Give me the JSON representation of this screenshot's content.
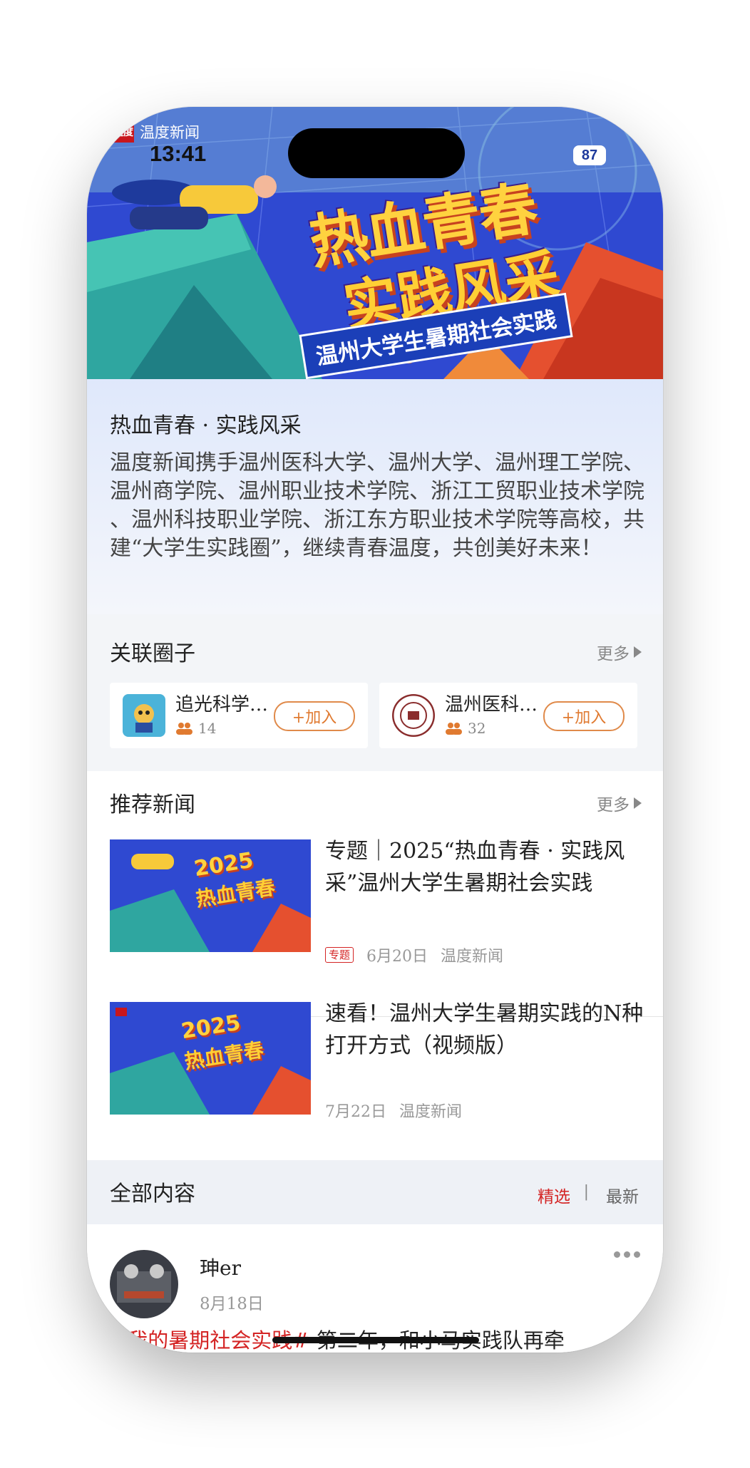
{
  "status_bar": {
    "app_name": "温度新闻",
    "app_logo_text": "温度",
    "time": "13:41",
    "battery": "87"
  },
  "banner": {
    "title_line1": "热血青春",
    "title_line2": "实践风采",
    "subtitle": "温州大学生暑期社会实践"
  },
  "intro": {
    "title": "热血青春 · 实践风采",
    "description": "温度新闻携手温州医科大学、温州大学、温州理工学院、温州商学院、温州职业技术学院、浙江工贸职业技术学院 、温州科技职业学院、浙江东方职业技术学院等高校，共建“大学生实践圈”，继续青春温度，共创美好未来！"
  },
  "circles": {
    "heading": "关联圈子",
    "more": "更多",
    "items": [
      {
        "name": "追光科学…",
        "members": "14",
        "join": "+加入"
      },
      {
        "name": "温州医科…",
        "members": "32",
        "join": "+加入"
      }
    ]
  },
  "news": {
    "heading": "推荐新闻",
    "more": "更多",
    "items": [
      {
        "title": "专题｜2025“热血青春 · 实践风采”温州大学生暑期社会实践",
        "tag": "专题",
        "date": "6月20日",
        "source": "温度新闻",
        "thumb_year": "2025"
      },
      {
        "title": "速看！温州大学生暑期实践的N种打开方式（视频版）",
        "date": "7月22日",
        "source": "温度新闻",
        "thumb_year": "2025"
      }
    ]
  },
  "all_content": {
    "heading": "全部内容",
    "tab_selected": "精选",
    "separator": "|",
    "tab_latest": "最新"
  },
  "post": {
    "user": "珅er",
    "date": "8月18日",
    "hashtag": "#我的暑期社会实践#",
    "text": " 第二年，和小马实践队再牵"
  },
  "colors": {
    "accent_red": "#d42424",
    "join_orange": "#e07a30",
    "banner_blue": "#2f49d1"
  }
}
